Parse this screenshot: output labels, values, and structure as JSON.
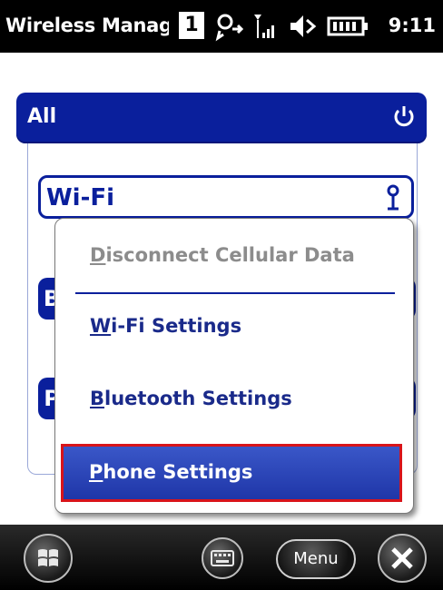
{
  "status_bar": {
    "title": "Wireless Manage",
    "notification_count": "1",
    "time": "9:11",
    "icons": [
      "notification-count-icon",
      "sync-icon",
      "signal-icon",
      "speaker-icon",
      "battery-icon"
    ]
  },
  "main": {
    "header_label": "All",
    "wifi_label": "Wi-Fi",
    "peek_bluetooth_initial": "B",
    "peek_phone_initial": "P"
  },
  "context_menu": {
    "items": [
      {
        "label_prefix": "",
        "accel": "D",
        "label_rest": "isconnect Cellular Data",
        "enabled": false
      },
      {
        "label_prefix": "",
        "accel": "W",
        "label_rest": "i-Fi Settings",
        "enabled": true
      },
      {
        "label_prefix": "",
        "accel": "B",
        "label_rest": "luetooth Settings",
        "enabled": true
      },
      {
        "label_prefix": "",
        "accel": "P",
        "label_rest": "hone Settings",
        "enabled": true,
        "selected": true
      }
    ]
  },
  "bottom_bar": {
    "start_icon": "windows-start-icon",
    "keyboard_icon": "keyboard-icon",
    "menu_label": "Menu",
    "close_icon": "close-icon"
  },
  "colors": {
    "accent": "#0a1f9c",
    "selection": "#2a44b8",
    "highlight_border": "#d8141a"
  }
}
